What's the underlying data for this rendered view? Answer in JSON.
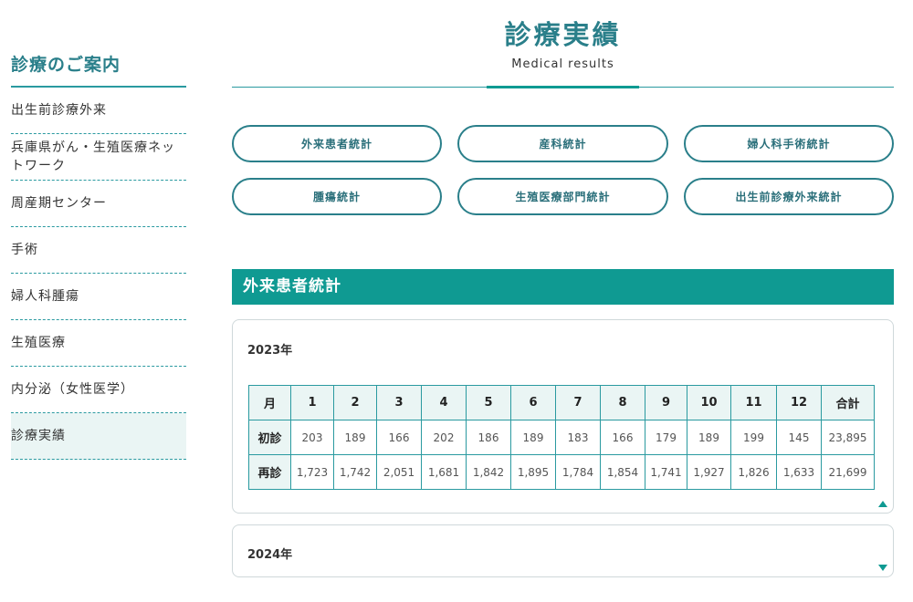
{
  "sidebar": {
    "title": "診療のご案内",
    "items": [
      {
        "label": "出生前診療外来"
      },
      {
        "label": "兵庫県がん・生殖医療ネットワーク"
      },
      {
        "label": "周産期センター"
      },
      {
        "label": "手術"
      },
      {
        "label": "婦人科腫瘍"
      },
      {
        "label": "生殖医療"
      },
      {
        "label": "内分泌（女性医学）"
      },
      {
        "label": "診療実績"
      }
    ]
  },
  "header": {
    "title": "診療実績",
    "subtitle": "Medical results"
  },
  "buttons": [
    "外来患者統計",
    "産科統計",
    "婦人科手術統計",
    "腫瘍統計",
    "生殖医療部門統計",
    "出生前診療外来統計"
  ],
  "section": {
    "title": "外来患者統計"
  },
  "years": [
    {
      "label": "2023年",
      "expanded": true,
      "table": {
        "headers": [
          "月",
          "1",
          "2",
          "3",
          "4",
          "5",
          "6",
          "7",
          "8",
          "9",
          "10",
          "11",
          "12",
          "合計"
        ],
        "rows": [
          {
            "label": "初診",
            "values": [
              "203",
              "189",
              "166",
              "202",
              "186",
              "189",
              "183",
              "166",
              "179",
              "189",
              "199",
              "145",
              "23,895"
            ]
          },
          {
            "label": "再診",
            "values": [
              "1,723",
              "1,742",
              "2,051",
              "1,681",
              "1,842",
              "1,895",
              "1,784",
              "1,854",
              "1,741",
              "1,927",
              "1,826",
              "1,633",
              "21,699"
            ]
          }
        ]
      }
    },
    {
      "label": "2024年",
      "expanded": false
    }
  ],
  "colors": {
    "accent": "#0f9a92",
    "heading": "#2a7f8a",
    "table_header_bg": "#eaf5f4"
  }
}
